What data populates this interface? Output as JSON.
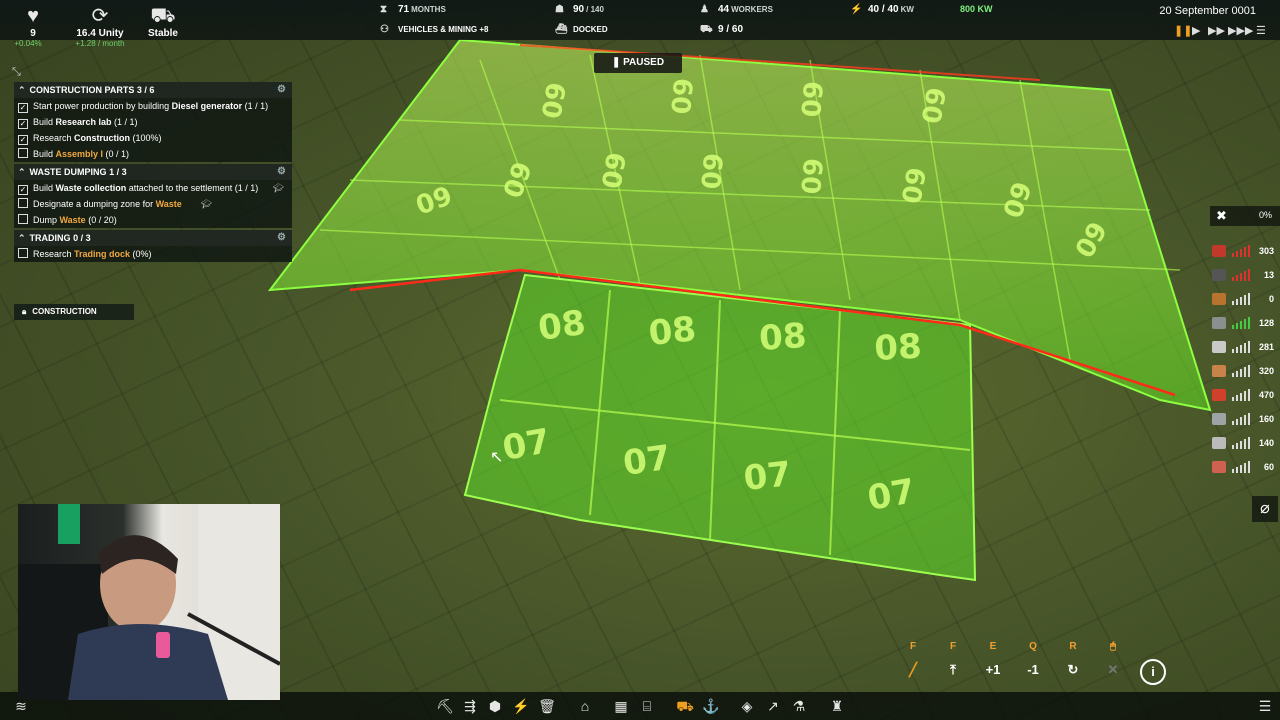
{
  "topbar": {
    "health": {
      "icon": "heart-icon",
      "value": "9",
      "sub": "+0.04%"
    },
    "unity": {
      "icon": "unity-icon",
      "value": "16.4 Unity",
      "sub": "+1.28 / month"
    },
    "status": {
      "icon": "truck-icon",
      "value": "Stable"
    },
    "months": {
      "value": "71",
      "unit": "MONTHS"
    },
    "vehicles": {
      "value": "VEHICLES & MINING +8"
    },
    "food": {
      "value": "90",
      "unit": "/ 140"
    },
    "ship": {
      "value": "DOCKED"
    },
    "workers": {
      "value": "44",
      "unit": "WORKERS"
    },
    "trucks": {
      "value": "9 / 60"
    },
    "power": {
      "value": "40 / 40",
      "unit": "KW",
      "badge": "800 KW"
    },
    "date": "20 September 0001"
  },
  "paused_label": "PAUSED",
  "goals": [
    {
      "title": "CONSTRUCTION PARTS",
      "count": "3 / 6",
      "items": [
        {
          "checked": true,
          "pre": "Start power production by building ",
          "key": "Diesel generator",
          "post": " (1 / 1)",
          "orange": false
        },
        {
          "checked": true,
          "pre": "Build ",
          "key": "Research lab",
          "post": " (1 / 1)",
          "orange": false
        },
        {
          "checked": true,
          "pre": "Research ",
          "key": "Construction",
          "post": " (100%)",
          "orange": false
        },
        {
          "checked": false,
          "pre": "Build ",
          "key": "Assembly I",
          "post": " (0 / 1)",
          "orange": true
        }
      ]
    },
    {
      "title": "WASTE DUMPING",
      "count": "1 / 3",
      "items": [
        {
          "checked": true,
          "pre": "Build ",
          "key": "Waste collection",
          "post": " attached to the settlement (1 / 1)",
          "orange": false
        },
        {
          "checked": false,
          "pre": "Designate a dumping zone for ",
          "key": "Waste",
          "post": "",
          "orange": true
        },
        {
          "checked": false,
          "pre": "Dump ",
          "key": "Waste",
          "post": " (0 / 20)",
          "orange": true
        }
      ]
    },
    {
      "title": "TRADING",
      "count": "0 / 3",
      "items": [
        {
          "checked": false,
          "pre": "Research ",
          "key": "Trading dock",
          "post": " (0%)",
          "orange": true
        }
      ]
    }
  ],
  "construction_tag": "CONSTRUCTION",
  "right_tools": {
    "percent": "0%"
  },
  "resources": [
    {
      "name": "iron-ore",
      "color": "#c0392b",
      "value": "303",
      "bar_color": "#e03030"
    },
    {
      "name": "coal",
      "color": "#555555",
      "value": "13",
      "bar_color": "#e03030"
    },
    {
      "name": "wood",
      "color": "#b8732e",
      "value": "0",
      "bar_color": "#dddddd"
    },
    {
      "name": "rock",
      "color": "#8a8f90",
      "value": "128",
      "bar_color": "#44cc44"
    },
    {
      "name": "construction-parts",
      "color": "#c9c9c9",
      "value": "281",
      "bar_color": "#dddddd"
    },
    {
      "name": "planks",
      "color": "#c7834a",
      "value": "320",
      "bar_color": "#dddddd"
    },
    {
      "name": "diesel",
      "color": "#d0402a",
      "value": "470",
      "bar_color": "#dddddd"
    },
    {
      "name": "iron",
      "color": "#9ea3a6",
      "value": "160",
      "bar_color": "#dddddd"
    },
    {
      "name": "tools",
      "color": "#bbbbbb",
      "value": "140",
      "bar_color": "#dddddd"
    },
    {
      "name": "bricks",
      "color": "#d06050",
      "value": "60",
      "bar_color": "#dddddd"
    }
  ],
  "hotkeys": [
    {
      "key": "F",
      "action": "pipette-icon",
      "glyph": "╱"
    },
    {
      "key": "F",
      "action": "flip-icon",
      "glyph": "⤒"
    },
    {
      "key": "E",
      "action": "raise-icon",
      "glyph": "+1"
    },
    {
      "key": "Q",
      "action": "lower-icon",
      "glyph": "-1"
    },
    {
      "key": "R",
      "action": "rotate-icon",
      "glyph": "↻"
    },
    {
      "key": "🖱",
      "action": "cancel-icon",
      "glyph": "✕"
    }
  ],
  "grid_labels": {
    "back": "09",
    "middle": "08",
    "front": "07"
  },
  "colors": {
    "accent": "#f0a020",
    "green": "#6fe06f",
    "grid": "#7dff3a",
    "warn": "#ff2a1a"
  }
}
